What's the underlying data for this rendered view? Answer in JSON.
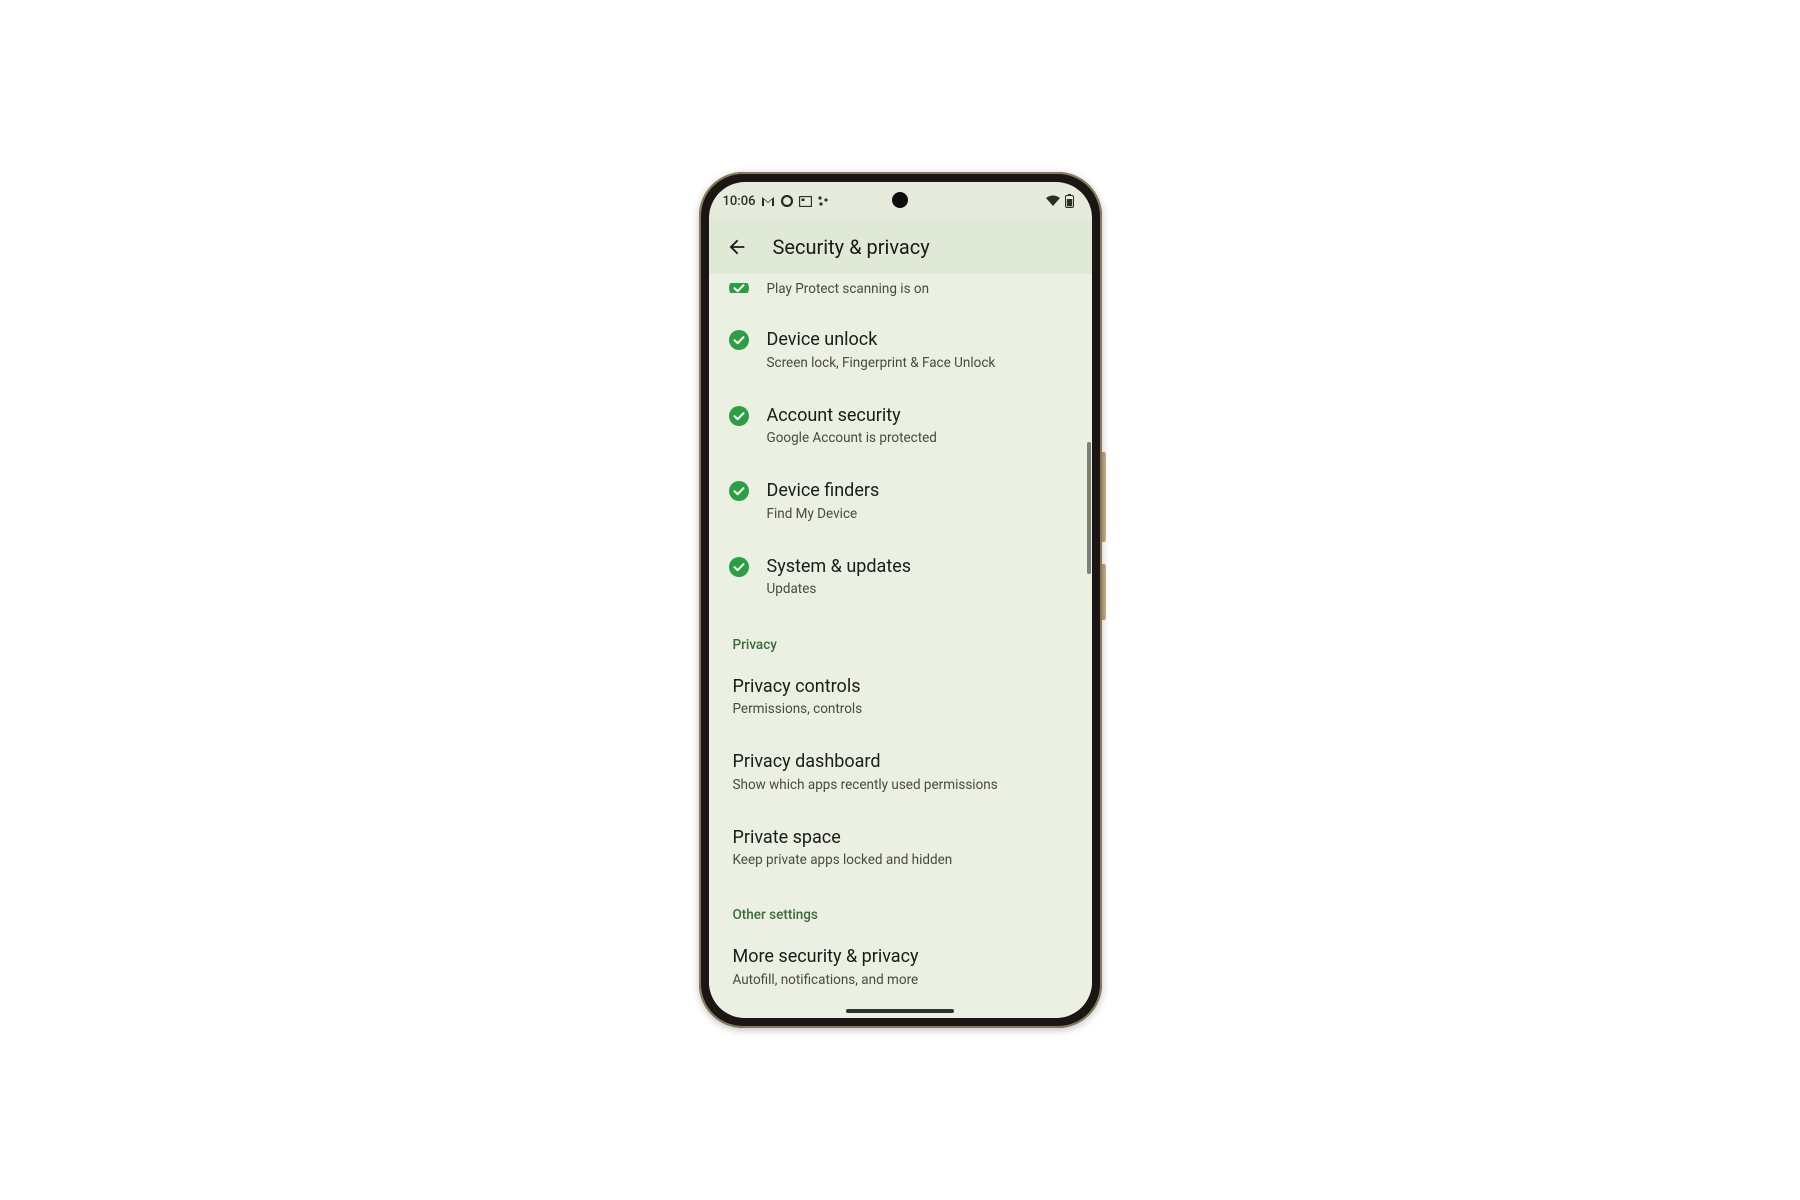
{
  "status_bar": {
    "time": "10:06",
    "icon1_name": "gmail-icon",
    "icon2_name": "circle-icon",
    "icon3_name": "card-icon",
    "icon4_name": "dots-icon",
    "wifi_name": "wifi-icon",
    "battery_name": "battery-icon"
  },
  "app_bar": {
    "title": "Security & privacy"
  },
  "items": {
    "play_protect_sub": "Play Protect scanning is on",
    "device_unlock": {
      "title": "Device unlock",
      "sub": "Screen lock, Fingerprint & Face Unlock"
    },
    "account_security": {
      "title": "Account security",
      "sub": "Google Account is protected"
    },
    "device_finders": {
      "title": "Device finders",
      "sub": "Find My Device"
    },
    "system_updates": {
      "title": "System & updates",
      "sub": "Updates"
    }
  },
  "section_privacy": "Privacy",
  "privacy_items": {
    "controls": {
      "title": "Privacy controls",
      "sub": "Permissions, controls"
    },
    "dashboard": {
      "title": "Privacy dashboard",
      "sub": "Show which apps recently used permissions"
    },
    "private_space": {
      "title": "Private space",
      "sub": "Keep private apps locked and hidden"
    }
  },
  "section_other": "Other settings",
  "other_items": {
    "more": {
      "title": "More security & privacy",
      "sub": "Autofill, notifications, and more"
    }
  },
  "colors": {
    "check_green": "#2e9e46"
  }
}
